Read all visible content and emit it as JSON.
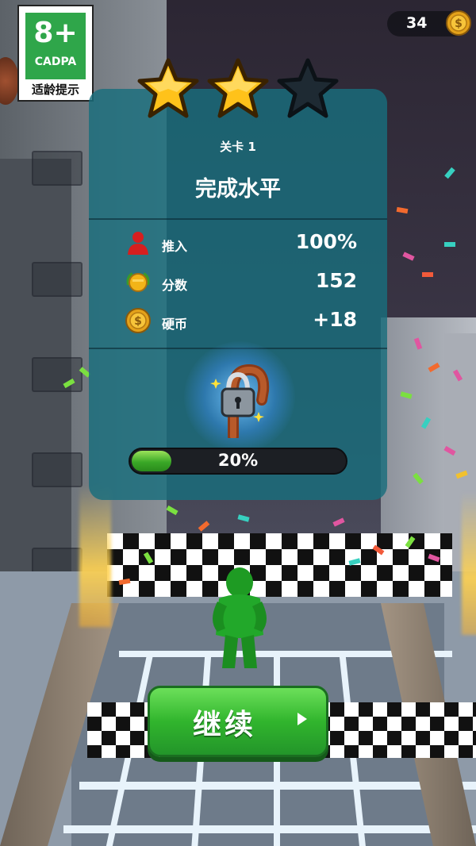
{
  "age_rating": {
    "value": "8+",
    "org": "CADPA",
    "tip": "适龄提示"
  },
  "coins": {
    "count": "34",
    "icon": "coin-icon"
  },
  "results": {
    "stars_earned": 2,
    "stars_total": 3,
    "level_label": "关卡 1",
    "title": "完成水平",
    "stats": [
      {
        "icon": "person-icon",
        "label": "推入",
        "value": "100%"
      },
      {
        "icon": "medal-icon",
        "label": "分数",
        "value": "152"
      },
      {
        "icon": "coin-icon",
        "label": "硬币",
        "value": "+18"
      }
    ],
    "unlock": {
      "icon": "locked-candy-cane-icon",
      "progress": 0.2,
      "progress_label": "20%"
    }
  },
  "continue_button": {
    "label": "继续",
    "icon": "play-arrow-icon"
  },
  "colors": {
    "panel": "#186e7d",
    "button": "#31b52d",
    "star_gold": "#ffc21a",
    "star_empty": "#1e2a33"
  }
}
